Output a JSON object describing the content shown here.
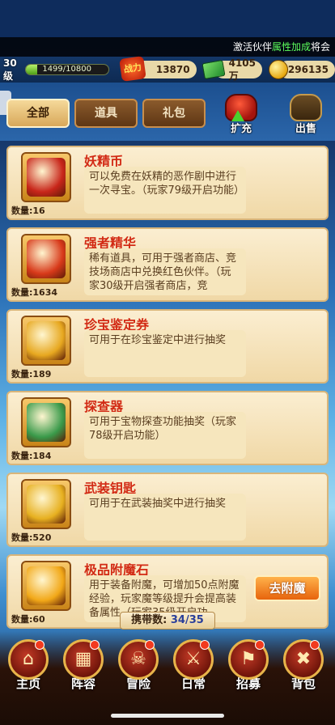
{
  "ticker": {
    "pre": "激活伙伴",
    "highlight": "属性加成",
    "post": "将会"
  },
  "status": {
    "level": "30级",
    "xp_text": "1499/10800",
    "xp_progress": 0.139,
    "power_badge": "战力",
    "power": "13870",
    "cash": "4105万",
    "gold": "296135"
  },
  "tabs": [
    {
      "label": "全部",
      "active": true
    },
    {
      "label": "道具",
      "active": false
    },
    {
      "label": "礼包",
      "active": false
    }
  ],
  "actions": {
    "expand": "扩充",
    "sell": "出售"
  },
  "items": [
    {
      "name": "妖精币",
      "qty": "数量:16",
      "desc": "可以免费在妖精的恶作剧中进行一次寻宝。（玩家79级开启功能）",
      "icon": "fairy-coin-icon",
      "color": "#c8261a"
    },
    {
      "name": "强者精华",
      "qty": "数量:1634",
      "desc": "稀有道具，可用于强者商店、竞技场商店中兑换红色伙伴。（玩家30级开启强者商店，竞",
      "icon": "red-crystal-icon",
      "color": "#d83a1a"
    },
    {
      "name": "珍宝鉴定券",
      "qty": "数量:189",
      "desc": "可用于在珍宝鉴定中进行抽奖",
      "icon": "magnifier-icon",
      "color": "#e7a820"
    },
    {
      "name": "探查器",
      "qty": "数量:184",
      "desc": "可用于宝物探查功能抽奖（玩家78级开启功能）",
      "icon": "detector-icon",
      "color": "#3a9a4a"
    },
    {
      "name": "武装钥匙",
      "qty": "数量:520",
      "desc": "可用于在武装抽奖中进行抽奖",
      "icon": "key-icon",
      "color": "#e7b020"
    },
    {
      "name": "极品附魔石",
      "qty": "数量:60",
      "desc": "用于装备附魔，可增加50点附魔经验，玩家魔等级提升会提高装备属性（玩家35级开启功",
      "icon": "enchant-stone-icon",
      "color": "#f2a818",
      "button": "去附魔"
    }
  ],
  "capacity": {
    "label": "携带数:",
    "value": "34/35"
  },
  "nav": [
    {
      "label": "主页",
      "icon": "home-icon",
      "glyph": "⌂",
      "badge": true
    },
    {
      "label": "阵容",
      "icon": "lineup-icon",
      "glyph": "▦",
      "badge": true
    },
    {
      "label": "冒险",
      "icon": "adventure-skull-icon",
      "glyph": "☠",
      "badge": true
    },
    {
      "label": "日常",
      "icon": "daily-swords-icon",
      "glyph": "⚔",
      "badge": true
    },
    {
      "label": "招募",
      "icon": "recruit-icon",
      "glyph": "⚑",
      "badge": true
    },
    {
      "label": "背包",
      "icon": "backpack-icon",
      "glyph": "✖",
      "badge": true
    }
  ]
}
